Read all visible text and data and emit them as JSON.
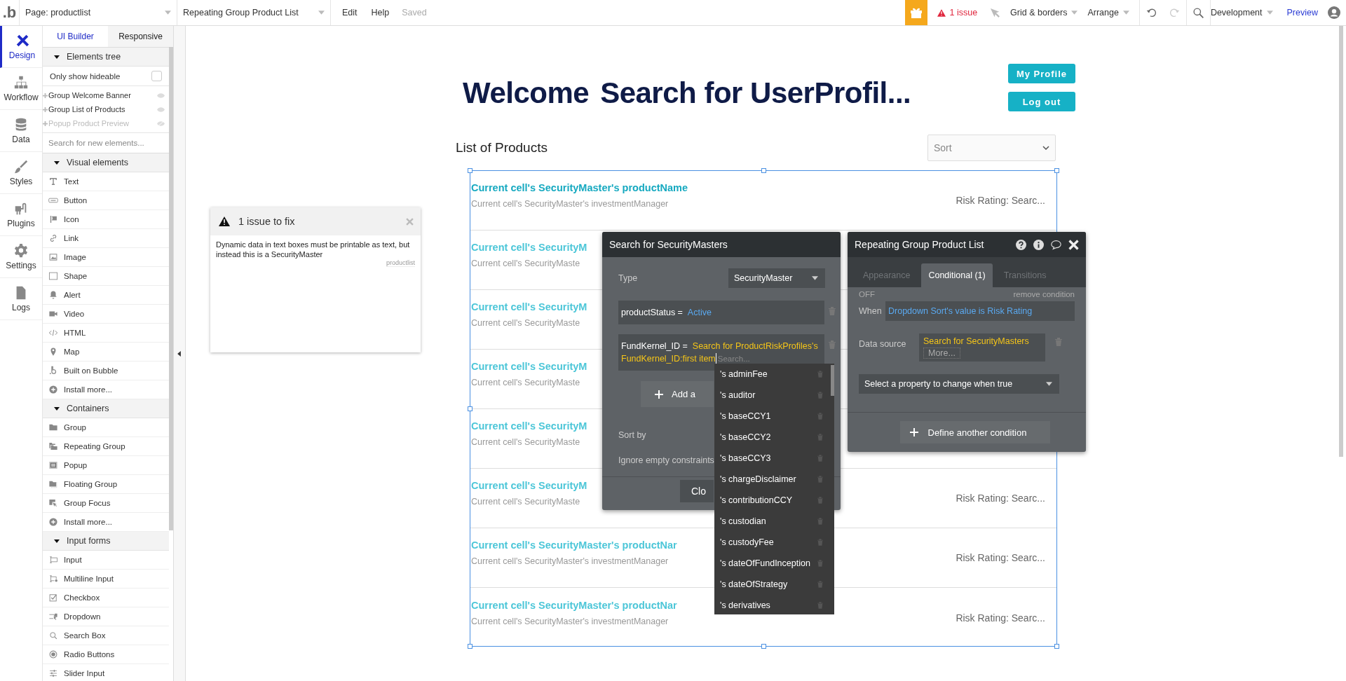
{
  "topbar": {
    "logo": ".b",
    "page_selector": "Page: productlist",
    "element_selector": "Repeating Group Product List",
    "menu": [
      "Edit",
      "Help"
    ],
    "save_status": "Saved",
    "issues": "1 issue",
    "grid": "Grid & borders",
    "arrange": "Arrange",
    "mode": "Development",
    "preview": "Preview"
  },
  "nav": [
    {
      "label": "Design",
      "selected": true
    },
    {
      "label": "Workflow",
      "selected": false
    },
    {
      "label": "Data",
      "selected": false
    },
    {
      "label": "Styles",
      "selected": false
    },
    {
      "label": "Plugins",
      "selected": false
    },
    {
      "label": "Settings",
      "selected": false
    },
    {
      "label": "Logs",
      "selected": false
    }
  ],
  "panel_tabs": [
    {
      "label": "UI Builder",
      "selected": true
    },
    {
      "label": "Responsive",
      "selected": false
    }
  ],
  "elements_tree": {
    "title": "Elements tree",
    "expanded": true,
    "hideable_label": "Only show hideable",
    "hideable_checked": false,
    "items": [
      {
        "label": "Group Welcome Banner",
        "hidden": false
      },
      {
        "label": "Group List of Products",
        "hidden": false
      },
      {
        "label": "Popup Product Preview",
        "hidden": true
      }
    ],
    "search_placeholder": "Search for new elements..."
  },
  "element_sections": [
    {
      "title": "Visual elements",
      "expanded": true,
      "items": [
        "Text",
        "Button",
        "Icon",
        "Link",
        "Image",
        "Shape",
        "Alert",
        "Video",
        "HTML",
        "Map",
        "Built on Bubble",
        "Install more..."
      ]
    },
    {
      "title": "Containers",
      "expanded": true,
      "items": [
        "Group",
        "Repeating Group",
        "Popup",
        "Floating Group",
        "Group Focus",
        "Install more..."
      ]
    },
    {
      "title": "Input forms",
      "expanded": true,
      "items": [
        "Input",
        "Multiline Input",
        "Checkbox",
        "Dropdown",
        "Search Box",
        "Radio Buttons",
        "Slider Input"
      ]
    }
  ],
  "page": {
    "welcome": "Welcome",
    "welcome_name": "Search for UserProfil...",
    "header_buttons": [
      "My Profile",
      "Log out"
    ],
    "list_title": "List of Products",
    "sort_value": "Sort",
    "rows": [
      {
        "title": "Current cell's SecurityMaster's productName",
        "subtitle": "Current cell's SecurityMaster's investmentManager",
        "risk": "Risk Rating: Searc...",
        "faded": false
      },
      {
        "title": "Current cell's SecurityM",
        "subtitle": "Current cell's SecurityMaste",
        "faded": true
      },
      {
        "title": "Current cell's SecurityM",
        "subtitle": "Current cell's SecurityMaste",
        "faded": true
      },
      {
        "title": "Current cell's SecurityM",
        "subtitle": "Current cell's SecurityMaste",
        "faded": true
      },
      {
        "title": "Current cell's SecurityM",
        "subtitle": "Current cell's SecurityMaste",
        "faded": true
      },
      {
        "title": "Current cell's SecurityM",
        "subtitle": "Current cell's SecurityMaste",
        "risk": "Risk Rating: Searc...",
        "faded": true
      },
      {
        "title": "Current cell's SecurityMaster's productNar",
        "subtitle": "Current cell's SecurityMaster's investmentManager",
        "risk": "Risk Rating: Searc...",
        "faded": true
      },
      {
        "title": "Current cell's SecurityMaster's productNar",
        "subtitle": "Current cell's SecurityMaster's investmentManager",
        "risk": "Risk Rating: Searc...",
        "faded": true
      }
    ]
  },
  "issue_box": {
    "title": "1 issue to fix",
    "message": "Dynamic data in text boxes must be printable as text, but instead this is a SecurityMaster",
    "page": "productlist"
  },
  "search_panel": {
    "title": "Search for SecurityMasters",
    "type_label": "Type",
    "type_value": "SecurityMaster",
    "constraints": [
      {
        "field": "productStatus =",
        "value": "Active",
        "color": "#5aa9f0"
      },
      {
        "field": "FundKernel_ID =",
        "value": "Search for ProductRiskProfiles's FundKernel_ID:first item",
        "color": "#f5c518",
        "search_placeholder": "Search..."
      }
    ],
    "add_button": "Add a",
    "sort_label": "Sort by",
    "ignore_label": "Ignore empty constraints",
    "close_button": "Clo",
    "options": [
      "'s adminFee",
      "'s auditor",
      "'s baseCCY1",
      "'s baseCCY2",
      "'s baseCCY3",
      "'s chargeDisclaimer",
      "'s contributionCCY",
      "'s custodian",
      "'s custodyFee",
      "'s dateOfFundInception",
      "'s dateOfStrategy",
      "'s derivatives"
    ]
  },
  "property_panel": {
    "title": "Repeating Group Product List",
    "tabs": [
      {
        "label": "Appearance",
        "selected": false
      },
      {
        "label": "Conditional (1)",
        "selected": true
      },
      {
        "label": "Transitions",
        "selected": false
      }
    ],
    "condition_state": "OFF",
    "remove_label": "remove condition",
    "when_label": "When",
    "when_value": "Dropdown Sort's value is Risk Rating",
    "source_label": "Data source",
    "source_value": "Search for SecurityMasters",
    "more": "More...",
    "property_placeholder": "Select a property to change when true",
    "define_button": "Define another condition"
  }
}
